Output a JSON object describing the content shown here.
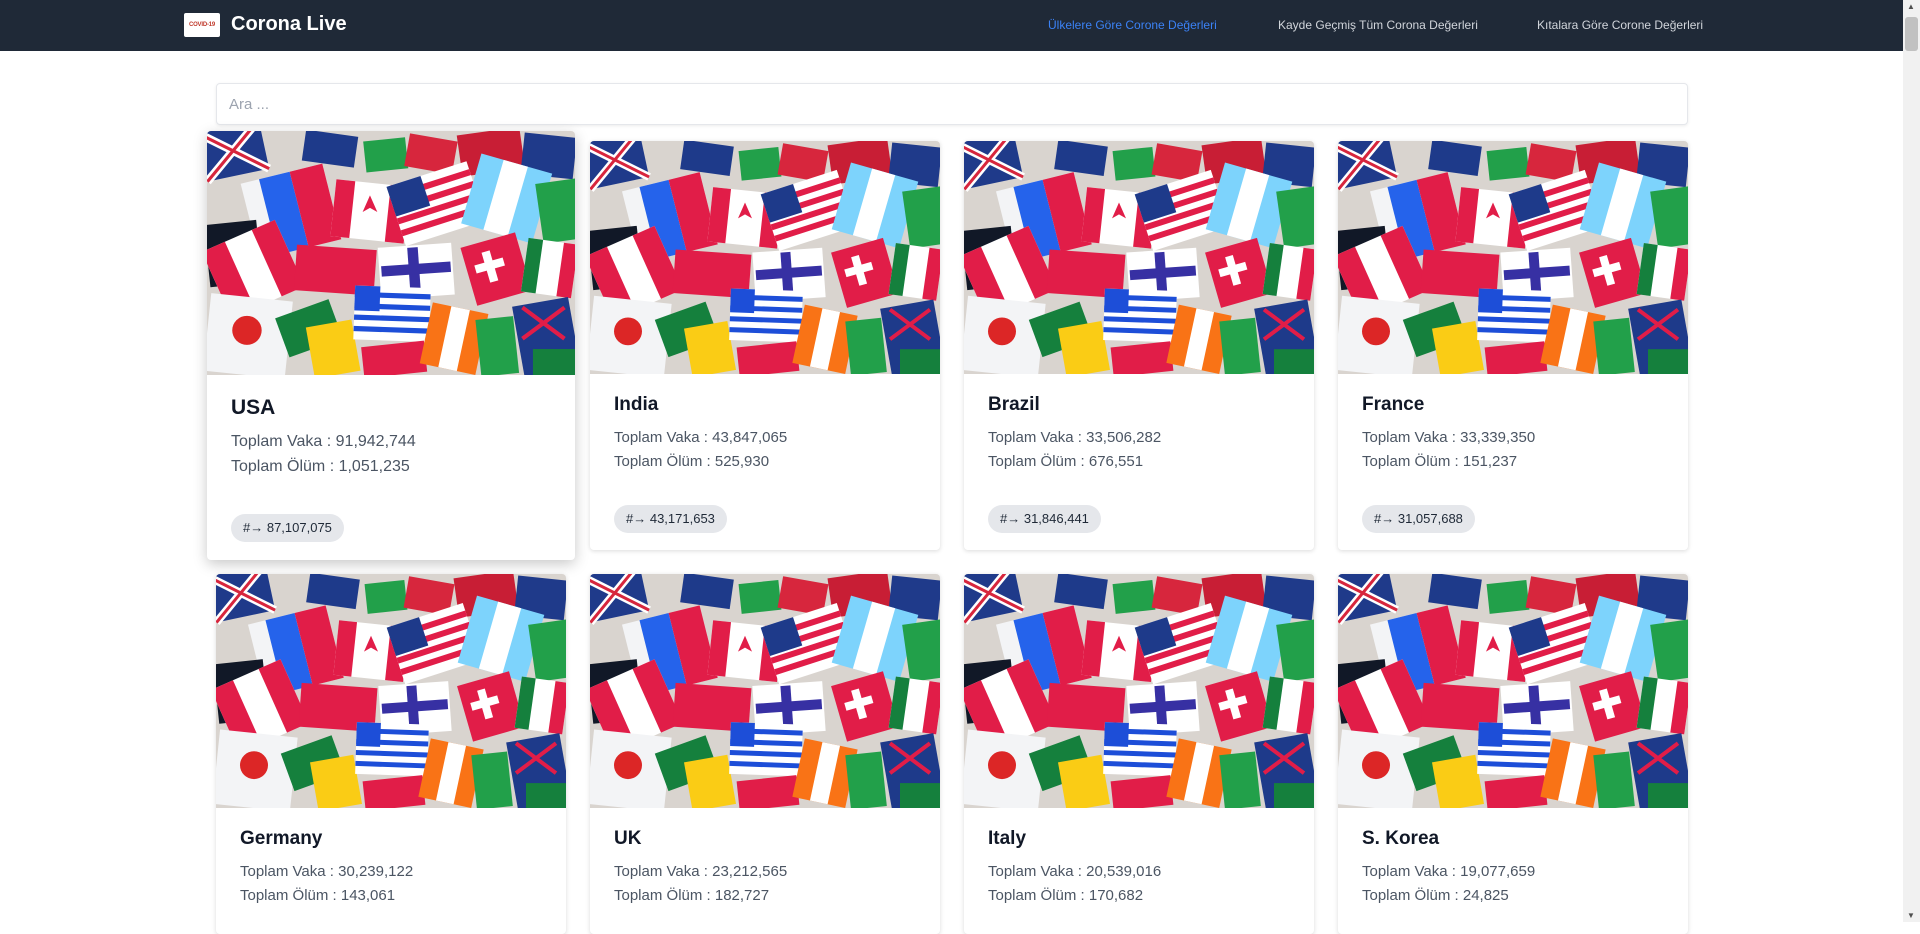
{
  "navbar": {
    "logo_text": "COVID-19",
    "title": "Corona Live",
    "links": [
      {
        "label": "Ülkelere Göre Corone Değerleri",
        "active": true
      },
      {
        "label": "Kayde Geçmiş Tüm Corona Değerleri",
        "active": false
      },
      {
        "label": "Kıtalara Göre Corone Değerleri",
        "active": false
      }
    ]
  },
  "search": {
    "placeholder": "Ara ..."
  },
  "cards": [
    {
      "name": "USA",
      "cases_line": "Toplam Vaka : 91,942,744",
      "deaths_line": "Toplam Ölüm : 1,051,235",
      "badge": "#→ 87,107,075"
    },
    {
      "name": "India",
      "cases_line": "Toplam Vaka : 43,847,065",
      "deaths_line": "Toplam Ölüm : 525,930",
      "badge": "#→ 43,171,653"
    },
    {
      "name": "Brazil",
      "cases_line": "Toplam Vaka : 33,506,282",
      "deaths_line": "Toplam Ölüm : 676,551",
      "badge": "#→ 31,846,441"
    },
    {
      "name": "France",
      "cases_line": "Toplam Vaka : 33,339,350",
      "deaths_line": "Toplam Ölüm : 151,237",
      "badge": "#→ 31,057,688"
    },
    {
      "name": "Germany",
      "cases_line": "Toplam Vaka : 30,239,122",
      "deaths_line": "Toplam Ölüm : 143,061",
      "badge": ""
    },
    {
      "name": "UK",
      "cases_line": "Toplam Vaka : 23,212,565",
      "deaths_line": "Toplam Ölüm : 182,727",
      "badge": ""
    },
    {
      "name": "Italy",
      "cases_line": "Toplam Vaka : 20,539,016",
      "deaths_line": "Toplam Ölüm : 170,682",
      "badge": ""
    },
    {
      "name": "S. Korea",
      "cases_line": "Toplam Vaka : 19,077,659",
      "deaths_line": "Toplam Ölüm : 24,825",
      "badge": ""
    }
  ]
}
